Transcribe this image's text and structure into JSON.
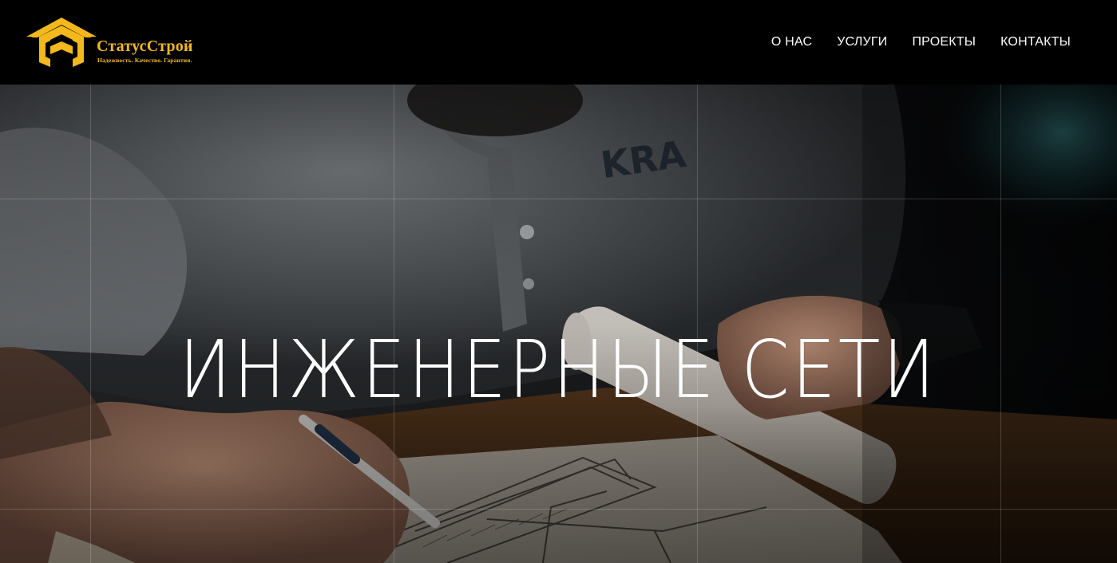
{
  "brand": {
    "name": "СтатусСтрой",
    "tagline": "Надежность. Качество. Гарантия."
  },
  "nav": {
    "items": [
      {
        "label": "О НАС"
      },
      {
        "label": "УСЛУГИ"
      },
      {
        "label": "ПРОЕКТЫ"
      },
      {
        "label": "КОНТАКТЫ"
      }
    ]
  },
  "hero": {
    "title": "ИНЖЕНЕРНЫЕ СЕТИ",
    "image_icon": "engineer-drawing-blueprint-photo"
  },
  "colors": {
    "header_bg": "#000000",
    "brand_accent": "#f3b81b",
    "nav_text": "#ffffff",
    "hero_title": "#ffffff"
  }
}
